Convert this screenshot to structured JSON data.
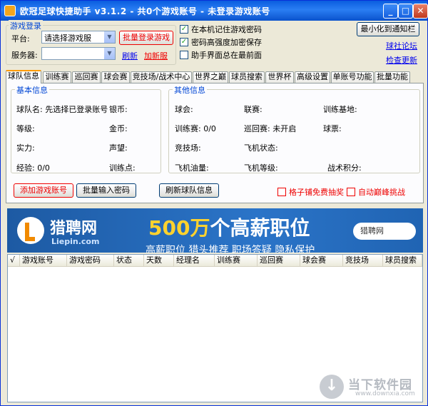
{
  "window": {
    "title": "欧冠足球快捷助手  v3.1.2  - 共0个游戏账号 - 未登录游戏账号",
    "minimize_symbol": "_",
    "maximize_symbol": "□",
    "close_symbol": "✕"
  },
  "login": {
    "group_title": "游戏登录",
    "platform_label": "平台:",
    "platform_value": "请选择游戏服",
    "server_label": "服务器:",
    "server_value": "",
    "batch_login_button": "批量登录游戏",
    "refresh_link": "刷新",
    "add_server_link": "加新服"
  },
  "options": {
    "remember_password": {
      "label": "在本机记住游戏密码",
      "checked": true
    },
    "strong_encrypt": {
      "label": "密码高强度加密保存",
      "checked": true
    },
    "always_on_top": {
      "label": "助手界面总在最前面",
      "checked": false
    }
  },
  "side": {
    "minimize_tray_button": "最小化到通知栏",
    "forum_link": "球社论坛",
    "check_update_link": "检查更新"
  },
  "tabs": [
    "球队信息",
    "训练赛",
    "巡回赛",
    "球会赛",
    "竞技场/战术中心",
    "世界之巅",
    "球员搜索",
    "世界杯",
    "高级设置",
    "单账号功能",
    "批量功能"
  ],
  "basic": {
    "title": "基本信息",
    "team_name": "球队名: 先选择已登录账号",
    "silver": "银币:",
    "level": "等级:",
    "gold": "金币:",
    "strength": "实力:",
    "prestige": "声望:",
    "exp": "经验: 0/0",
    "training_points": "训练点:"
  },
  "other": {
    "title": "其他信息",
    "club": "球会:",
    "league": "联赛:",
    "training_base": "训练基地:",
    "training_match": "训练赛: 0/0",
    "tour": "巡回赛: 未开启",
    "tickets": "球票:",
    "arena": "竞技场:",
    "plane_status": "飞机状态:",
    "plane_fuel": "飞机油量:",
    "plane_level": "飞机等级:",
    "tactic_points": "战术积分:"
  },
  "actions": {
    "add_account": "添加游戏账号",
    "batch_password": "批量输入密码",
    "refresh_team": "刷新球队信息",
    "free_draw": {
      "label": "格子铺免费抽奖",
      "checked": false
    },
    "auto_challenge": {
      "label": "自动巅峰挑战",
      "checked": false
    }
  },
  "ad": {
    "brand": "猎聘网",
    "domain": "Liepin.com",
    "headline_num": "500万",
    "headline_rest": "个高薪职位",
    "sub": "高薪职位 猎头推荐 职场答疑 隐私保护",
    "search": "猎聘网"
  },
  "grid": {
    "columns": [
      "√",
      "游戏账号",
      "游戏密码",
      "状态",
      "天数",
      "经理名",
      "训练赛",
      "巡回赛",
      "球会赛",
      "竞技场",
      "球员搜索"
    ]
  },
  "watermark": {
    "text": "当下软件园",
    "sub": "www.downxia.com"
  }
}
